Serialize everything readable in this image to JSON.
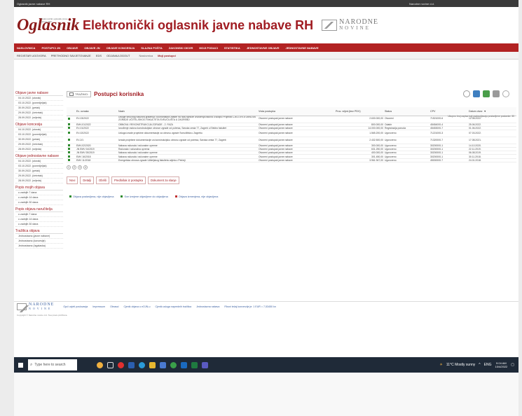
{
  "app": {
    "window_title": "Elektronički oglasnik javne nabave RH",
    "title_left": "Oglasnik javne nabave RH",
    "title_right": "Narodne novine d.d."
  },
  "header": {
    "logo_text": "Oglasnik",
    "logo_small": "Elektronički oglasnik javne nabave RH",
    "site_title": "Elektronički oglasnik javne nabave RH",
    "nn_top": "NARODNE",
    "nn_bottom": "NOVINE"
  },
  "red_menu": [
    "NASLOVNICA",
    "POSTUPCI JN",
    "OBJAVE",
    "OBJAVE JN",
    "OBJAVE KONCESIJA",
    "SLAJNA POŠTA",
    "ZAKONSKI OKVIR",
    "MOJI PODACI",
    "STATISTIKA",
    "JEDNOSTAVNE OBJAVE",
    "JEDNOSTAVNE NABAVE"
  ],
  "sub_menu": [
    "REGISTAR UGOVORA",
    "PRETHODNO SAVJETOVANJE",
    "EDS",
    "ODJAVA/LOGOUT"
  ],
  "breadcrumb": {
    "home": "Naslovnica",
    "current": "Moji postupci"
  },
  "sidebar": {
    "sections": [
      {
        "title": "Objave javne nabave",
        "items": [
          "04.10.2022. (utorak)",
          "03.10.2022. (ponedjeljak)",
          "30.09.2022. (petak)",
          "29.09.2022. (četvrtak)",
          "28.09.2022. (srijeda)"
        ]
      },
      {
        "title": "Objave koncesija",
        "items": [
          "04.10.2022. (utorak)",
          "03.10.2022. (ponedjeljak)",
          "30.09.2022. (petak)",
          "29.09.2022. (četvrtak)",
          "28.09.2022. (srijeda)"
        ]
      },
      {
        "title": "Objave jednostavne nabave",
        "items": [
          "04.10.2022. (utorak)",
          "03.10.2022. (ponedjeljak)",
          "30.09.2022. (petak)",
          "29.09.2022. (četvrtak)",
          "28.09.2022. (srijeda)"
        ]
      },
      {
        "title": "Popis mojih objava",
        "items": [
          "u zadnjih 7 dana",
          "u zadnjih 14 dana",
          "u zadnjih 30 dana"
        ]
      },
      {
        "title": "Popis objava naručitelja",
        "items": [
          "u zadnjih 7 dana",
          "u zadnjih 14 dana",
          "u zadnjih 30 dana"
        ]
      },
      {
        "title": "Tražilica objava",
        "items": [
          "Jednostavna (javne nabave)",
          "Jednostavna (koncesije)",
          "Jednostavna (Izgalaska)"
        ]
      }
    ]
  },
  "main": {
    "tab_label": "TRAŽIMO:",
    "page_title": "Postupci korisnika",
    "columns": [
      "Ev. oznaka",
      "Naziv",
      "Vrsta postupka",
      "Proc. vrijed.(bez PDV)",
      "Status",
      "CPV",
      "Datum otvor. ▼"
    ],
    "rows": [
      {
        "ev": "EV-03/2022",
        "naziv": "Usluge stručnog nadzora građenja i koordinatora zaštite na radu tijekom izvođenja radova u sklopu Projekta CJELOVITA OBNOVA ZGRADE UČITELJSKOG FAKULTETA SVEUČILIŠTA U ZAGREBU",
        "vrsta": "Otvoreni postupak javne nabave",
        "vrijednost": "2.630.000,00",
        "status": "Otvoreni",
        "cpv": "71521000-6",
        "datum": "12.08.2022.",
        "tall": true
      },
      {
        "ev": "EMV-01/2022",
        "naziv": "OBNOVA I REKONSTRUKCIJA ZGRADE - 2. FAZA",
        "vrsta": "Otvoreni postupak javne nabave",
        "vrijednost": "800.000,00",
        "status": "Odabir",
        "cpv": "45454000-4",
        "datum": "25.06.2022.",
        "tall": false
      },
      {
        "ev": "EV-01/2022",
        "naziv": "Izvođenje radova konstrukcijske obnove zgrade od potresa, Savska cesta 77, Zagreb u Elektro fakultet",
        "vrsta": "Otvoreni postupak javne nabave",
        "vrijednost": "14.000.000,00",
        "status": "Registracija ponuda",
        "cpv": "45453000-7",
        "datum": "01.06.2022.",
        "tall": false
      },
      {
        "ev": "EV-02/2022",
        "naziv": "Usluga izrade projektne dokumentacije za obnovu zgrade Sveučilišta u Zagrebu",
        "vrsta": "Otvoreni postupak javne nabave",
        "vrijednost": "1.565.200,00",
        "status": "Ugovoreno",
        "cpv": "71221000-3",
        "datum": "07.03.2022.",
        "tall": true
      },
      {
        "ev": "EV-2/1",
        "naziv": "Izrada projektne dokumentacije za konstrukcijsku obnovu zgrade od potresa, Savska cesta 77, Zagreb",
        "vrsta": "Otvoreni postupak javne nabave",
        "vrijednost": "2.432.500,00",
        "status": "Ugovoreno",
        "cpv": "71320000-7",
        "datum": "17.08.2021.",
        "tall": true
      },
      {
        "ev": "EMV-02/2020",
        "naziv": "Nabava računala i računalne opreme",
        "vrsta": "Otvoreni postupak javne nabave",
        "vrijednost": "300.000,00",
        "status": "Ugovoreno",
        "cpv": "30200000-1",
        "datum": "14.10.2020.",
        "tall": false
      },
      {
        "ev": "JN EMV 04/2019",
        "naziv": "Računala i računalna oprema",
        "vrsta": "Otvoreni postupak javne nabave",
        "vrijednost": "631.250,00",
        "status": "Ugovoreno",
        "cpv": "30200000-1",
        "datum": "22.11.2019.",
        "tall": false
      },
      {
        "ev": "JN EMV 05/2019",
        "naziv": "Nabava računala i računalne opreme",
        "vrsta": "Otvoreni postupak javne nabave",
        "vrijednost": "400.000,00",
        "status": "Ugovoreno",
        "cpv": "30200000-1",
        "datum": "06.08.2019.",
        "tall": false
      },
      {
        "ev": "EMV 16/2018",
        "naziv": "Nabava računala i računalne opreme",
        "vrsta": "Otvoreni postupak javne nabave",
        "vrijednost": "301.450,00",
        "status": "Ugovoreno",
        "cpv": "30200000-1",
        "datum": "30.11.2018.",
        "tall": false
      },
      {
        "ev": "EMV 11/2018",
        "naziv": "Energetska obnova zgrade Učiteljskog fakulteta odjela u Petrinji",
        "vrsta": "Otvoreni postupak javne nabave",
        "vrijednost": "3.961.947,00",
        "status": "Ugovoreno",
        "cpv": "45000000-7",
        "datum": "24.01.2018.",
        "tall": false
      }
    ],
    "pager": [
      "1",
      "2",
      "3",
      "4"
    ],
    "pager_note": "Ukupno broj zapisa koji zadovoljavaju postavljene postavke: 30",
    "buttons": [
      "Novi",
      "Detalji",
      "Obriši",
      "Predlošak iz postupka",
      "Dokument za slanje"
    ],
    "legend": [
      {
        "label": "Objava postavljena, nije objavljena",
        "color": "#2e8b2e"
      },
      {
        "label": "Sve izmjene objavljene do objavljena",
        "color": "#2e8b2e"
      },
      {
        "label": "Objava izmenjena, nije objavljena",
        "color": "#c03030"
      }
    ]
  },
  "footer": {
    "links": [
      "Opći uvjeti poslovanja",
      "Impressum",
      "Obrasci",
      "Cjenik objava u eOJN-u",
      "Cjenik usluga naprednih tražilica",
      "Jednostavna nabava",
      "Fiksni tečaj konverzije je: 1 EUR = 7,53450 kn"
    ],
    "copyright": "Copyright © Narodne novine d.d. Sva prava pridržana.",
    "nn_top": "NARODNE",
    "nn_bottom": "NOVINE"
  },
  "taskbar": {
    "search_placeholder": "Type here to search",
    "weather": "11°C Mostly sunny",
    "time": "9:04 AM",
    "date": "10/4/2022",
    "lang": "ENG"
  },
  "colors": {
    "brand_red": "#a01c22",
    "menu_red": "#b22222",
    "link_blue": "#3a5fa0",
    "taskbar": "#1f2a38"
  }
}
